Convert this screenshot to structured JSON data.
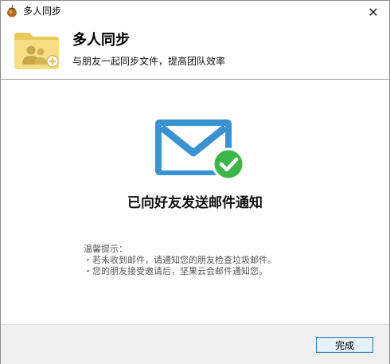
{
  "window": {
    "title": "多人同步",
    "close_label": "✕"
  },
  "header": {
    "title": "多人同步",
    "subtitle": "与朋友一起同步文件，提高团队效率",
    "icon": "shared-folder-icon"
  },
  "content": {
    "icon": "mail-sent-icon",
    "message": "已向好友发送邮件通知",
    "tips_title": "温馨提示：",
    "tips": [
      "・若未收到邮件，请通知您的朋友检查垃圾邮件。",
      "・您的朋友接受邀请后，坚果云会邮件通知您。"
    ]
  },
  "footer": {
    "done_label": "完成"
  },
  "colors": {
    "mail_blue": "#3a93d0",
    "check_green": "#3cb649",
    "folder_yellow": "#f2d876",
    "button_border": "#3c7fb1"
  }
}
